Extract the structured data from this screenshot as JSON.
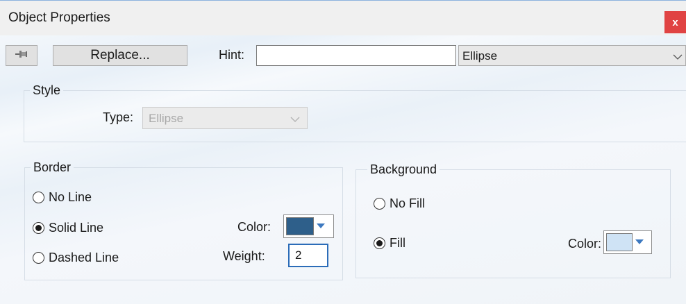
{
  "window": {
    "title": "Object Properties",
    "close_label": "x"
  },
  "toolbar": {
    "pin_icon": "pushpin-icon",
    "replace_label": "Replace...",
    "hint_label": "Hint:",
    "hint_value": "",
    "shape_value": "Ellipse"
  },
  "style": {
    "legend": "Style",
    "type_label": "Type:",
    "type_value": "Ellipse"
  },
  "border": {
    "legend": "Border",
    "options": [
      "No Line",
      "Solid Line",
      "Dashed Line"
    ],
    "selected": "Solid Line",
    "color_label": "Color:",
    "color": "#2e5f8a",
    "weight_label": "Weight:",
    "weight_value": "2"
  },
  "background": {
    "legend": "Background",
    "options": [
      "No Fill",
      "Fill"
    ],
    "selected": "Fill",
    "color_label": "Color:",
    "color": "#cfe3f5"
  },
  "colors": {
    "close_button": "#e04343",
    "dropdown_arrow": "#3d79c0",
    "focus_border": "#2b6cb8"
  }
}
